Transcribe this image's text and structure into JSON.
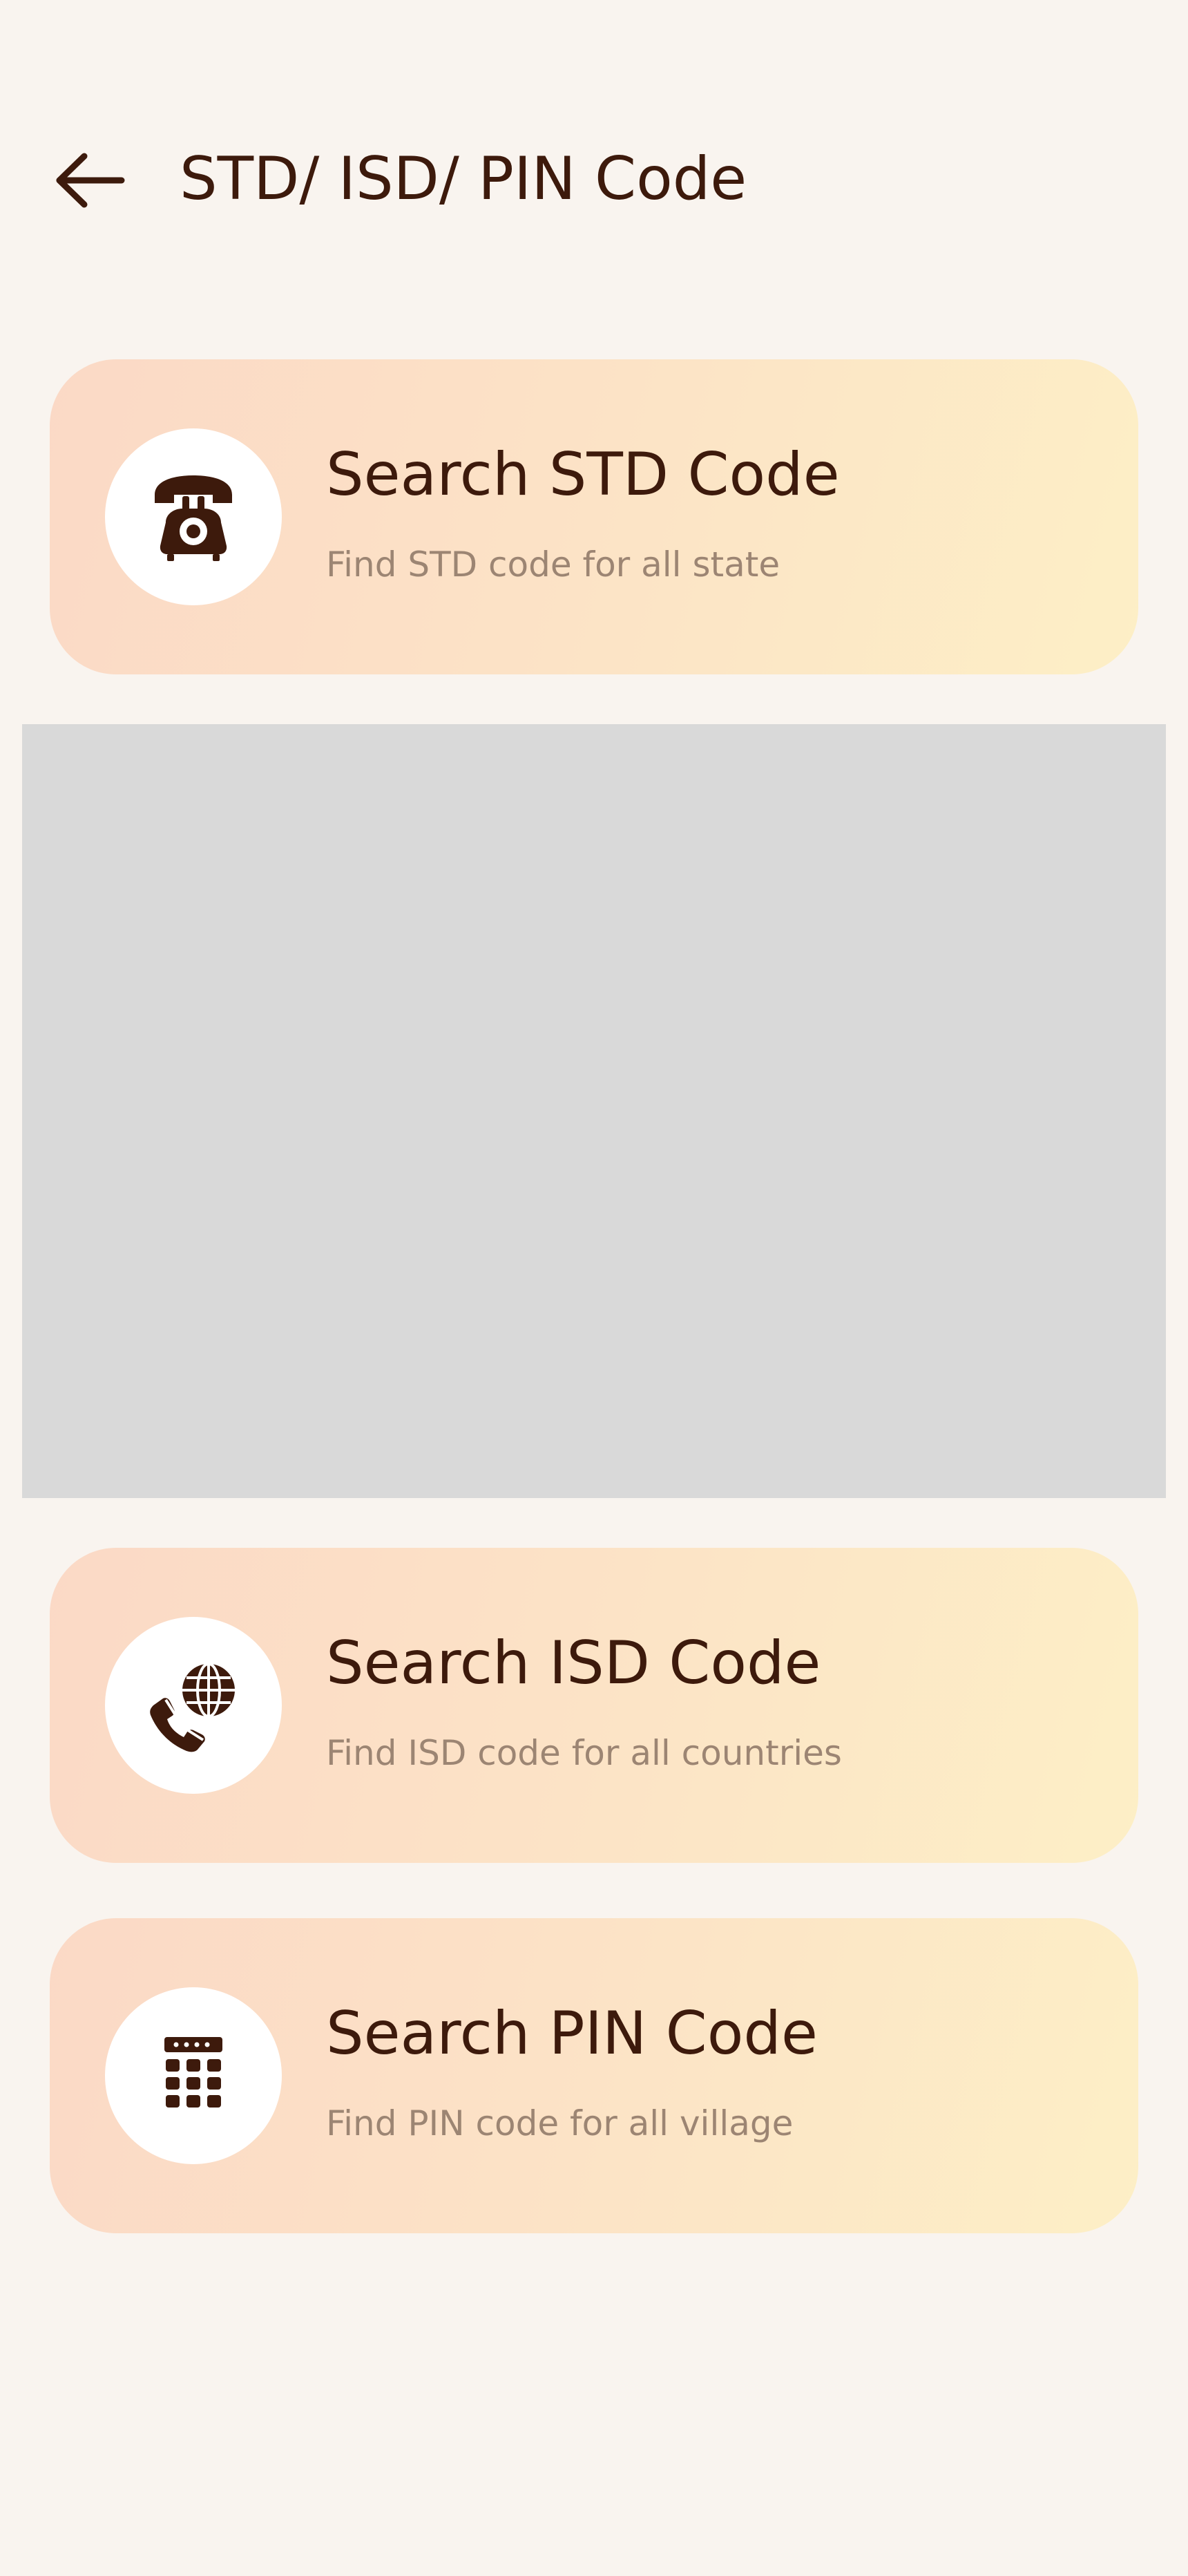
{
  "header": {
    "back_icon": "arrow-left-icon",
    "title": "STD/ ISD/ PIN Code"
  },
  "colors": {
    "background": "#f9f4ef",
    "text_primary": "#3d1a0c",
    "text_secondary": "#9c8573",
    "card_gradient_start": "#fbd9c6",
    "card_gradient_end": "#fdefc6",
    "placeholder": "#d9d9d9"
  },
  "cards": [
    {
      "icon": "telephone-icon",
      "title": "Search STD Code",
      "subtitle": "Find STD code for all state"
    },
    {
      "icon": "phone-globe-icon",
      "title": "Search ISD Code",
      "subtitle": "Find ISD code for all countries"
    },
    {
      "icon": "pin-grid-icon",
      "title": "Search PIN Code",
      "subtitle": "Find PIN code for all village"
    }
  ]
}
